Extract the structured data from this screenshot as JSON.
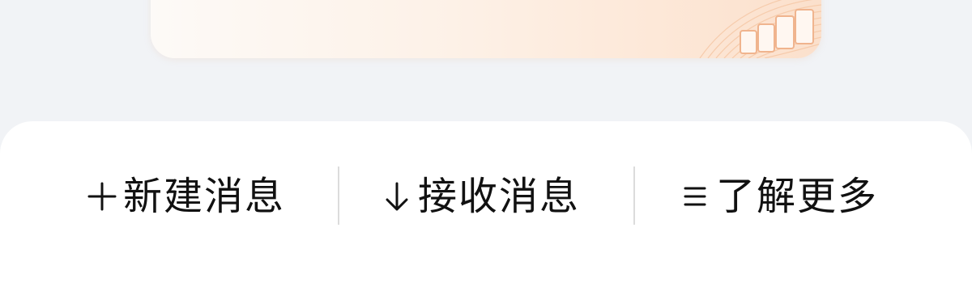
{
  "banner": {
    "illustration": "orange-gradient-card-with-stacked-boxes"
  },
  "actions": {
    "new_message": {
      "icon": "plus-icon",
      "label": "新建消息"
    },
    "receive_message": {
      "icon": "arrow-down-icon",
      "label": "接收消息"
    },
    "learn_more": {
      "icon": "menu-icon",
      "label": "了解更多"
    }
  },
  "colors": {
    "background": "#f1f3f6",
    "panel": "#ffffff",
    "text": "#111111",
    "divider": "#dcdcdc",
    "accent_light": "#fde8d8",
    "accent": "#f2b896"
  }
}
